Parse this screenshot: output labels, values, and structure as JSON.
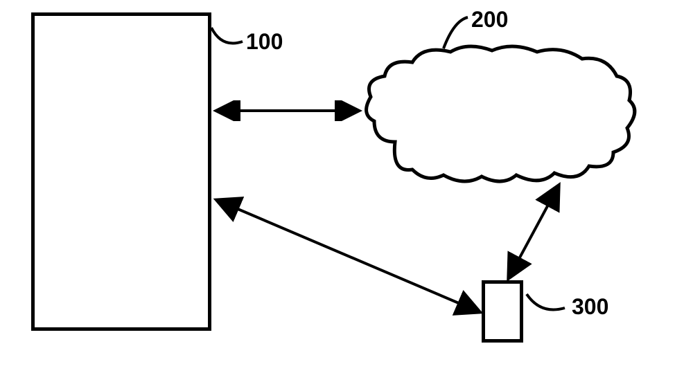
{
  "diagram": {
    "node1": {
      "label": "100",
      "shape": "rectangle-large"
    },
    "node2": {
      "label": "200",
      "shape": "cloud"
    },
    "node3": {
      "label": "300",
      "shape": "rectangle-small"
    },
    "connections": [
      {
        "from": "node1",
        "to": "node2",
        "type": "bidirectional"
      },
      {
        "from": "node1",
        "to": "node3",
        "type": "bidirectional"
      },
      {
        "from": "node2",
        "to": "node3",
        "type": "bidirectional"
      }
    ]
  }
}
